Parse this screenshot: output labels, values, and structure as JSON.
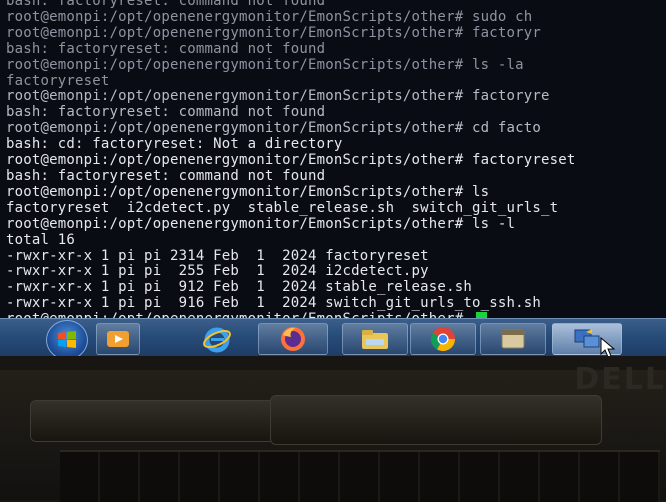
{
  "terminal": {
    "lines": [
      {
        "text": "bash: factoryreset: command not found",
        "style": "faded"
      },
      {
        "text": "root@emonpi:/opt/openenergymonitor/EmonScripts/other# sudo ch",
        "style": "faded"
      },
      {
        "text": "root@emonpi:/opt/openenergymonitor/EmonScripts/other# factoryr",
        "style": "faded"
      },
      {
        "text": "bash: factoryreset: command not found",
        "style": "faded"
      },
      {
        "text": "root@emonpi:/opt/openenergymonitor/EmonScripts/other# ls -la",
        "style": "faded"
      },
      {
        "text": "factoryreset",
        "style": "faded"
      },
      {
        "text": "root@emonpi:/opt/openenergymonitor/EmonScripts/other# factoryre",
        "style": "blurry"
      },
      {
        "text": "bash: factoryreset: command not found",
        "style": "blurry"
      },
      {
        "text": "root@emonpi:/opt/openenergymonitor/EmonScripts/other# cd facto",
        "style": "blurry"
      },
      {
        "text": "bash: cd: factoryreset: Not a directory",
        "style": "normal"
      },
      {
        "text": "root@emonpi:/opt/openenergymonitor/EmonScripts/other# factoryreset",
        "style": "normal"
      },
      {
        "text": "bash: factoryreset: command not found",
        "style": "normal"
      },
      {
        "text": "root@emonpi:/opt/openenergymonitor/EmonScripts/other# ls",
        "style": "normal"
      },
      {
        "text": "factoryreset  i2cdetect.py  stable_release.sh  switch_git_urls_t",
        "style": "normal"
      },
      {
        "text": "root@emonpi:/opt/openenergymonitor/EmonScripts/other# ls -l",
        "style": "normal"
      },
      {
        "text": "total 16",
        "style": "normal"
      },
      {
        "text": "-rwxr-xr-x 1 pi pi 2314 Feb  1  2024 factoryreset",
        "style": "normal"
      },
      {
        "text": "-rwxr-xr-x 1 pi pi  255 Feb  1  2024 i2cdetect.py",
        "style": "normal"
      },
      {
        "text": "-rwxr-xr-x 1 pi pi  912 Feb  1  2024 stable_release.sh",
        "style": "normal"
      },
      {
        "text": "-rwxr-xr-x 1 pi pi  916 Feb  1  2024 switch_git_urls_to_ssh.sh",
        "style": "normal"
      },
      {
        "text": "root@emonpi:/opt/openenergymonitor/EmonScripts/other# ",
        "style": "normal"
      }
    ]
  },
  "taskbar": {
    "items": [
      {
        "icon": "windows-start-icon"
      },
      {
        "icon": "media-player-icon"
      },
      {
        "icon": "internet-explorer-icon"
      },
      {
        "icon": "firefox-icon"
      },
      {
        "icon": "file-explorer-icon"
      },
      {
        "icon": "chrome-icon"
      },
      {
        "icon": "app-window-icon"
      },
      {
        "icon": "remote-connection-icon"
      }
    ]
  },
  "laptop": {
    "brand": "DELL"
  },
  "colors": {
    "cursor": "#19d43a",
    "terminal_text": "#e6e8ee",
    "taskbar": "#274b78"
  }
}
